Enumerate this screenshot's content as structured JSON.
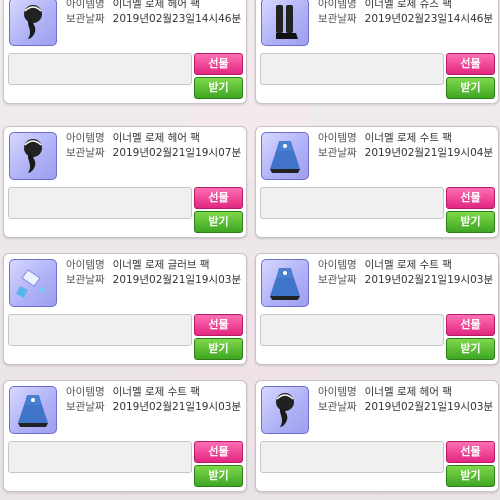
{
  "labels": {
    "item_name": "아이템명",
    "stored_date": "보관날짜",
    "gift_button": "선물",
    "receive_button": "받기"
  },
  "items": [
    {
      "name": "이너멜 로제 헤어 팩",
      "date": "2019년02월23일14시46분",
      "icon": "hair-icon"
    },
    {
      "name": "이너멜 로제 슈즈 팩",
      "date": "2019년02월23일14시46분",
      "icon": "shoes-icon"
    },
    {
      "name": "이너멜 로제 헤어 팩",
      "date": "2019년02월21일19시07분",
      "icon": "hair-icon"
    },
    {
      "name": "이너멜 로제 수트 팩",
      "date": "2019년02월21일19시04분",
      "icon": "suit-icon"
    },
    {
      "name": "이너멜 로제 글러브 팩",
      "date": "2019년02월21일19시03분",
      "icon": "glove-icon"
    },
    {
      "name": "이너멜 로제 수트 팩",
      "date": "2019년02월21일19시03분",
      "icon": "suit-icon"
    },
    {
      "name": "이너멜 로제 수트 팩",
      "date": "2019년02월21일19시03분",
      "icon": "suit-icon"
    },
    {
      "name": "이너멜 로제 헤어 팩",
      "date": "2019년02월21일19시03분",
      "icon": "hair-icon"
    }
  ],
  "colors": {
    "gift": "#e22680",
    "receive": "#3ea623",
    "thumb_bg": "#aeb0f6"
  }
}
